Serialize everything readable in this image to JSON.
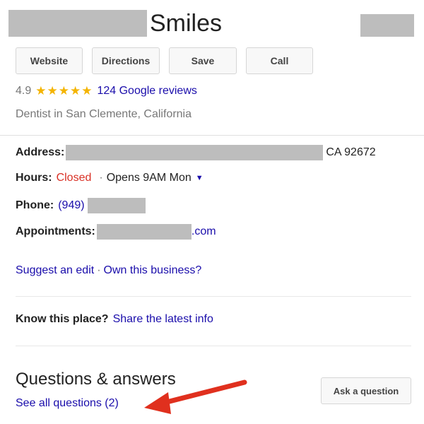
{
  "header": {
    "business_name": "Smiles"
  },
  "actions": [
    {
      "label": "Website"
    },
    {
      "label": "Directions"
    },
    {
      "label": "Save"
    },
    {
      "label": "Call"
    }
  ],
  "rating": {
    "score": "4.9",
    "stars": "★★★★★",
    "star_count": 5,
    "reviews_label": "124 Google reviews"
  },
  "category": "Dentist in San Clemente, California",
  "details": {
    "address_label": "Address:",
    "address_tail": "CA 92672",
    "hours_label": "Hours:",
    "hours_status": "Closed",
    "hours_separator": "·",
    "hours_next": "Opens 9AM Mon",
    "phone_label": "Phone:",
    "phone_area": "(949)",
    "appointments_label": "Appointments:",
    "appointments_tail": ".com"
  },
  "edit_links": {
    "suggest": "Suggest an edit",
    "separator": "·",
    "own": "Own this business?"
  },
  "know_place": {
    "prompt": "Know this place?",
    "link": "Share the latest info"
  },
  "qa": {
    "heading": "Questions & answers",
    "see_all": "See all questions (2)",
    "ask_button": "Ask a question"
  },
  "colors": {
    "link": "#1a0dab",
    "closed": "#d93025",
    "star": "#f4b400",
    "annotation_arrow": "#e0301e",
    "redaction": "#bdbdbd"
  }
}
